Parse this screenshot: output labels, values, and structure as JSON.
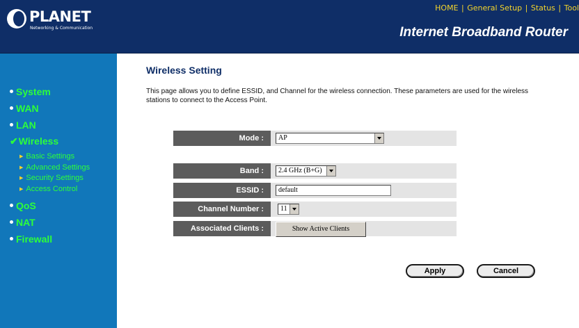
{
  "brand": {
    "name": "PLANET",
    "tagline": "Networking & Communication",
    "product_title": "Internet Broadband Router"
  },
  "top_nav": {
    "links": [
      "HOME",
      "General Setup",
      "Status",
      "Tool"
    ],
    "separator": "|"
  },
  "sidebar": {
    "items": [
      {
        "label": "System"
      },
      {
        "label": "WAN"
      },
      {
        "label": "LAN"
      },
      {
        "label": "Wireless",
        "active": true
      },
      {
        "label": "QoS"
      },
      {
        "label": "NAT"
      },
      {
        "label": "Firewall"
      }
    ],
    "wireless_subitems": [
      {
        "label": "Basic Settings"
      },
      {
        "label": "Advanced Settings"
      },
      {
        "label": "Security Settings"
      },
      {
        "label": "Access Control"
      }
    ]
  },
  "main": {
    "title": "Wireless Setting",
    "description": "This page allows you to define ESSID, and Channel for the wireless connection. These parameters are used for the wireless stations to connect to the Access Point."
  },
  "form": {
    "mode": {
      "label": "Mode :",
      "value": "AP"
    },
    "band": {
      "label": "Band :",
      "value": "2.4 GHz (B+G)"
    },
    "essid": {
      "label": "ESSID :",
      "value": "default"
    },
    "channel": {
      "label": "Channel Number :",
      "value": "11"
    },
    "clients": {
      "label": "Associated Clients :",
      "button_label": "Show Active Clients"
    }
  },
  "actions": {
    "apply_label": "Apply",
    "cancel_label": "Cancel"
  },
  "colors": {
    "header_bg": "#0f2e67",
    "sidebar_bg": "#1177ba",
    "nav_text": "#2dff3a",
    "top_nav_text": "#f3d42c",
    "label_cell_bg": "#5c5c5c",
    "row_bg": "#e4e4e4"
  },
  "icons": {
    "logo": "planet-logo",
    "nav_bullet": "dot-bullet-icon",
    "active_marker": "checkmark-icon",
    "sub_bullet": "triangle-right-icon",
    "dropdown": "chevron-down-icon"
  }
}
